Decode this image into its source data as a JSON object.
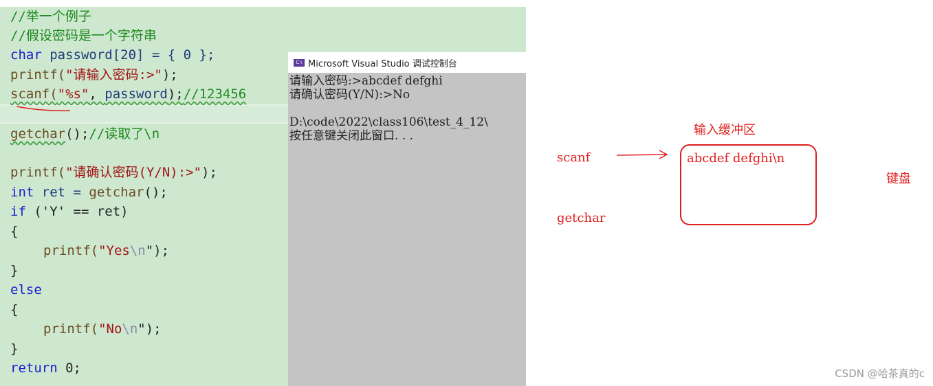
{
  "code": {
    "lines": [
      "//举一个例子",
      "//假设密码是一个字符串",
      "char",
      "password[20] = { 0 };",
      "printf(",
      "\"请输入密码:>\"",
      ");",
      "scanf(",
      "\"%s\"",
      ", ",
      "password",
      ");",
      "//123456",
      "getchar",
      "();",
      "//读取了\\n",
      "printf(",
      "\"请确认密码(Y/N):>\"",
      ");",
      "int",
      "ret = ",
      "getchar",
      "();",
      "if",
      "('Y' == ret)",
      "{",
      "printf(",
      "\"Yes",
      "\\n",
      "\");",
      "}",
      "else",
      "{",
      "printf(",
      "\"No",
      "\\n",
      "\");",
      "}",
      "return",
      "0;"
    ]
  },
  "console": {
    "title": "Microsoft Visual Studio 调试控制台",
    "icon": "console-app-icon",
    "output": [
      "请输入密码:>abcdef defghi",
      "请确认密码(Y/N):>No",
      "",
      "D:\\code\\2022\\class106\\test_4_12\\",
      "按任意键关闭此窗口. . ."
    ]
  },
  "annotations": {
    "buffer_title": "输入缓冲区",
    "buffer_content": "abcdef defghi\\n",
    "scanf": "scanf",
    "getchar": "getchar",
    "keyboard": "键盘",
    "color": "#e01e1e"
  },
  "watermark": "CSDN @哈茶真的c"
}
